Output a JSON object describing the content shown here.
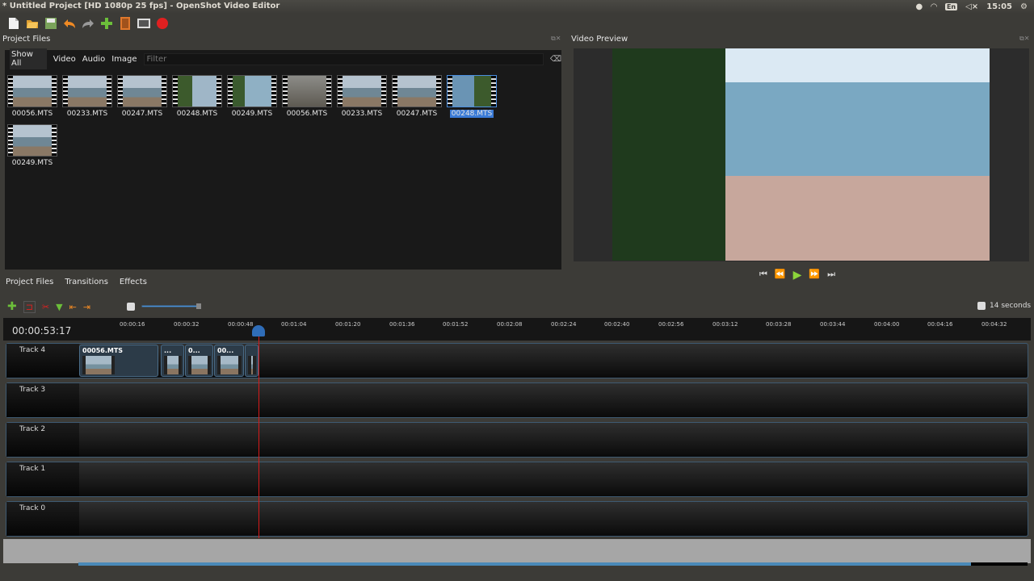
{
  "window": {
    "title": "* Untitled Project [HD 1080p 25 fps] - OpenShot Video Editor"
  },
  "tray": {
    "lang": "En",
    "clock": "15:05"
  },
  "toolbar": {
    "icons": [
      "new-project-icon",
      "open-project-icon",
      "save-project-icon",
      "undo-icon",
      "redo-icon",
      "import-files-icon",
      "choose-profile-icon",
      "fullscreen-icon",
      "export-video-icon"
    ]
  },
  "project_files": {
    "title": "Project Files",
    "filters": [
      "Show All",
      "Video",
      "Audio",
      "Image"
    ],
    "filter_placeholder": "Filter",
    "files": [
      {
        "name": "00056.MTS"
      },
      {
        "name": "00233.MTS"
      },
      {
        "name": "00247.MTS"
      },
      {
        "name": "00248.MTS"
      },
      {
        "name": "00249.MTS"
      },
      {
        "name": "00056.MTS"
      },
      {
        "name": "00233.MTS"
      },
      {
        "name": "00247.MTS"
      },
      {
        "name": "00248.MTS",
        "selected": true
      },
      {
        "name": "00249.MTS"
      }
    ]
  },
  "preview": {
    "title": "Video Preview"
  },
  "tabs": [
    "Project Files",
    "Transitions",
    "Effects"
  ],
  "timeline": {
    "zoom_label": "14 seconds",
    "zoom_level": 0.9,
    "current_time": "00:00:53:17",
    "ruler_ticks": [
      "00:00:16",
      "00:00:32",
      "00:00:48",
      "00:01:04",
      "00:01:20",
      "00:01:36",
      "00:01:52",
      "00:02:08",
      "00:02:24",
      "00:02:40",
      "00:02:56",
      "00:03:12",
      "00:03:28",
      "00:03:44",
      "00:04:00",
      "00:04:16",
      "00:04:32"
    ],
    "tracks": [
      "Track 4",
      "Track 3",
      "Track 2",
      "Track 1",
      "Track 0"
    ],
    "clips": [
      {
        "title": "00056.MTS"
      },
      {
        "title": "..."
      },
      {
        "title": "0..."
      },
      {
        "title": "00..."
      },
      {
        "title": ""
      }
    ]
  }
}
